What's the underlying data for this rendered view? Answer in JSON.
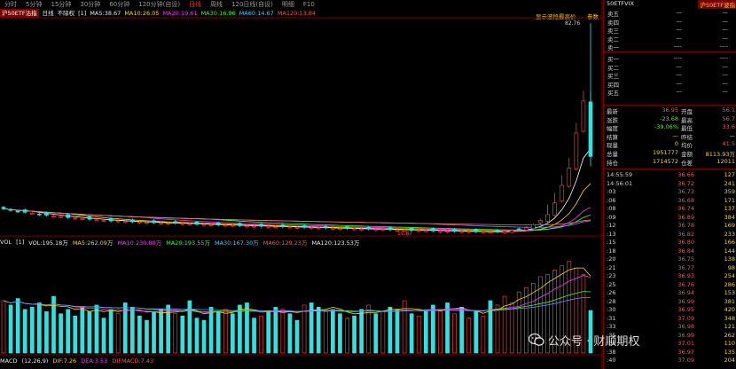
{
  "tabs": [
    "分时",
    "5分钟",
    "15分钟",
    "30分钟",
    "60分钟",
    "120分钟(自设)",
    "日线",
    "周线",
    "120日线(自设)",
    "明细",
    "F10"
  ],
  "active_tab": "日线",
  "info": {
    "title": "沪50ETF沽指",
    "period": "日线",
    "fq": "不除权",
    "bracket": "[1]",
    "ma5": "MA5:38.67",
    "ma10": "MA10:26.05",
    "ma20": "MA20:19.61",
    "ma30": "MA30:16.96",
    "ma60": "MA60:14.67",
    "ma120": "MA120:13.84"
  },
  "toolbar": {
    "show_btn": "显示波段最高价",
    "param": "参数"
  },
  "chart_labels": {
    "max": "82.76",
    "min": "10.87"
  },
  "vol": {
    "name": "VOL",
    "bracket": "[1]",
    "vol": "VOL:195.18万",
    "ma5": "MA5:262.09万",
    "ma10": "MA10:230.80万",
    "ma20": "MA20:193.55万",
    "ma30": "MA30:167.30万",
    "ma60": "MA60:129.23万",
    "ma120": "MA120:123.53万"
  },
  "macd": {
    "name": "MACD",
    "params": "(12,26,9)",
    "dif": "DIF:7.26",
    "dea": "DEA:3.53",
    "val": "DIFMACD:7.43"
  },
  "panel": {
    "code": "50ETFVIX",
    "name": "沪50ETF波指",
    "asks": [
      {
        "label": "卖五",
        "price": "—",
        "vol": "—"
      },
      {
        "label": "卖四",
        "price": "—",
        "vol": "—"
      },
      {
        "label": "卖三",
        "price": "—",
        "vol": "—"
      },
      {
        "label": "卖二",
        "price": "—",
        "vol": "—"
      },
      {
        "label": "卖一",
        "price": "----",
        "vol": "----"
      }
    ],
    "bids": [
      {
        "label": "买一",
        "price": "----",
        "vol": "----"
      },
      {
        "label": "买二",
        "price": "—",
        "vol": "—"
      },
      {
        "label": "买三",
        "price": "—",
        "vol": "—"
      },
      {
        "label": "买四",
        "price": "—",
        "vol": "—"
      },
      {
        "label": "买五",
        "price": "—",
        "vol": "—"
      }
    ],
    "quotes": [
      {
        "k1": "最新",
        "v1": "36.95",
        "c1": "#ff5050",
        "k2": "开盘",
        "v2": "56.1",
        "c2": "#ff5050"
      },
      {
        "k1": "涨跌",
        "v1": "-23.68",
        "c1": "#33ff33",
        "k2": "最高",
        "v2": "56.7",
        "c2": "#ff5050"
      },
      {
        "k1": "幅度",
        "v1": "-39.06%",
        "c1": "#33ff33",
        "k2": "最低",
        "v2": "33.6",
        "c2": "#ff5050"
      },
      {
        "k1": "结算",
        "v1": "—",
        "c1": "#d0d0d0",
        "k2": "昨结",
        "v2": "—",
        "c2": "#d0d0d0"
      },
      {
        "k1": "现量",
        "v1": "0",
        "c1": "#ffd400",
        "k2": "均价",
        "v2": "41.5",
        "c2": "#ff5050"
      },
      {
        "k1": "总量",
        "v1": "1951777",
        "c1": "#ffd400",
        "k2": "金额",
        "v2": "8113.93万",
        "c2": "#ffd400"
      },
      {
        "k1": "持仓",
        "v1": "1714572",
        "c1": "#ffd400",
        "k2": "仓差",
        "v2": "12011",
        "c2": "#ffd400"
      }
    ],
    "ticks": [
      {
        "t": "14:55:59",
        "p": "36.66",
        "v": "127"
      },
      {
        "t": "14:56:01",
        "p": "36.72",
        "v": "241"
      },
      {
        "t": ":03",
        "p": "36.73",
        "v": "359"
      },
      {
        "t": ":06",
        "p": "36.68",
        "v": "171"
      },
      {
        "t": ":08",
        "p": "36.74",
        "v": "137"
      },
      {
        "t": ":09",
        "p": "36.89",
        "v": "384"
      },
      {
        "t": ":12",
        "p": "36.78",
        "v": "169"
      },
      {
        "t": ":13",
        "p": "36.82",
        "v": "233"
      },
      {
        "t": ":15",
        "p": "36.80",
        "v": "166"
      },
      {
        "t": ":18",
        "p": "36.84",
        "v": "144"
      },
      {
        "t": ":20",
        "p": "36.75",
        "v": "138"
      },
      {
        "t": ":21",
        "p": "36.77",
        "v": "98"
      },
      {
        "t": ":23",
        "p": "36.93",
        "v": "254"
      },
      {
        "t": ":25",
        "p": "36.76",
        "v": "286"
      },
      {
        "t": ":26",
        "p": "36.94",
        "v": "153"
      },
      {
        "t": ":28",
        "p": "36.99",
        "v": "381"
      },
      {
        "t": ":30",
        "p": "36.95",
        "v": "420"
      },
      {
        "t": ":31",
        "p": "37.09",
        "v": "348"
      },
      {
        "t": ":33",
        "p": "36.98",
        "v": "121"
      },
      {
        "t": ":35",
        "p": "36.99",
        "v": "262"
      },
      {
        "t": ":36",
        "p": "37.01",
        "v": "110"
      },
      {
        "t": ":38",
        "p": "36.97",
        "v": "135"
      },
      {
        "t": ":40",
        "p": "37.09",
        "v": "204"
      }
    ]
  },
  "watermark": "公众号 · 财顺期权",
  "colors": {
    "up": "#ff3333",
    "down": "#33e0e0",
    "ma5": "#ffffff",
    "ma10": "#ffd400",
    "ma20": "#ff33ff",
    "ma30": "#33ff33",
    "ma60": "#6a8cff",
    "ma120": "#ff7070",
    "grid_border": "#7a0000"
  },
  "chart_data": {
    "type": "candlestick",
    "title": "沪50ETF沽指 日线",
    "ylim": [
      10.87,
      82.76
    ],
    "description_points": {
      "close": [
        19,
        18.5,
        18,
        17.8,
        17.5,
        17,
        16.8,
        16.5,
        16.3,
        16,
        15.8,
        15.6,
        15.4,
        15.2,
        15,
        14.8,
        14.8,
        14.6,
        14.5,
        14.4,
        14.3,
        14.2,
        14.1,
        14,
        14,
        13.9,
        13.8,
        13.7,
        13.6,
        13.5,
        13.4,
        13.4,
        13.3,
        13.2,
        13.1,
        13,
        13,
        12.9,
        12.8,
        12.8,
        12.7,
        12.6,
        12.6,
        12.5,
        12.4,
        12.4,
        12.3,
        12.2,
        12.2,
        12.1,
        12,
        12,
        11.9,
        11.9,
        11.8,
        11.7,
        11.7,
        11.6,
        11.6,
        11.5,
        11.4,
        11.4,
        11.3,
        11.3,
        11.2,
        11.2,
        11.1,
        11.1,
        11,
        11,
        11.2,
        11.5,
        12,
        12.5,
        13.5,
        15,
        17,
        21,
        27,
        33,
        45,
        56,
        36.95
      ],
      "volume_wan": [
        240,
        220,
        250,
        200,
        210,
        230,
        190,
        260,
        180,
        200,
        170,
        210,
        190,
        220,
        160,
        200,
        180,
        230,
        210,
        170,
        150,
        190,
        200,
        220,
        180,
        170,
        240,
        160,
        150,
        210,
        190,
        200,
        180,
        220,
        230,
        160,
        170,
        190,
        210,
        200,
        180,
        150,
        220,
        230,
        210,
        190,
        200,
        180,
        160,
        170,
        200,
        220,
        180,
        190,
        210,
        200,
        240,
        180,
        170,
        190,
        220,
        200,
        230,
        180,
        210,
        160,
        190,
        170,
        240,
        220,
        260,
        230,
        280,
        300,
        320,
        350,
        360,
        380,
        400,
        420,
        390,
        360,
        195.18
      ]
    }
  }
}
